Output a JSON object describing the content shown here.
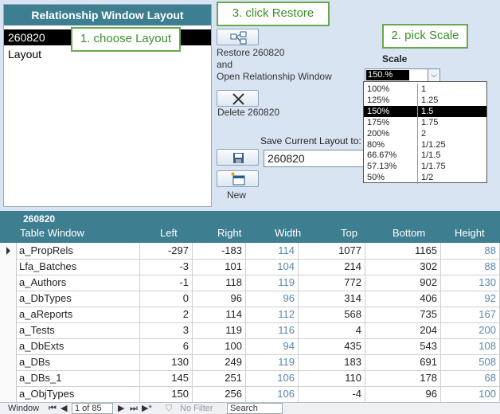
{
  "layout_list": {
    "title": "Relationship Window Layout",
    "items": [
      "260820",
      "Layout"
    ]
  },
  "callouts": {
    "choose": "1. choose Layout",
    "scale": "2. pick Scale",
    "restore": "3. click Restore"
  },
  "actions": {
    "restore_line1": "Restore 260820",
    "restore_line2": "and",
    "restore_line3": "Open Relationship Window",
    "delete_label": "Delete 260820",
    "new_label": "New",
    "save_label": "Save Current Layout to:",
    "save_value": "260820"
  },
  "scale": {
    "label": "Scale",
    "selected": "150.%",
    "options": [
      [
        "100%",
        "1"
      ],
      [
        "125%",
        "1.25"
      ],
      [
        "150%",
        "1.5"
      ],
      [
        "175%",
        "1.75"
      ],
      [
        "200%",
        "2"
      ],
      [
        "80%",
        "1/1.25"
      ],
      [
        "66.67%",
        "1/1.5"
      ],
      [
        "57.13%",
        "1/1.75"
      ],
      [
        "50%",
        "1/2"
      ]
    ],
    "selected_index": 2
  },
  "grid": {
    "caption": "260820",
    "columns": [
      "Table Window",
      "Left",
      "Right",
      "Width",
      "Top",
      "Bottom",
      "Height"
    ],
    "rows": [
      [
        "a_PropRels",
        "-297",
        "-183",
        "114",
        "1077",
        "1165",
        "88"
      ],
      [
        "Lfa_Batches",
        "-3",
        "101",
        "104",
        "214",
        "302",
        "88"
      ],
      [
        "a_Authors",
        "-1",
        "118",
        "119",
        "772",
        "902",
        "130"
      ],
      [
        "a_DbTypes",
        "0",
        "96",
        "96",
        "314",
        "406",
        "92"
      ],
      [
        "a_aReports",
        "2",
        "114",
        "112",
        "568",
        "735",
        "167"
      ],
      [
        "a_Tests",
        "3",
        "119",
        "116",
        "4",
        "204",
        "200"
      ],
      [
        "a_DbExts",
        "6",
        "100",
        "94",
        "435",
        "543",
        "108"
      ],
      [
        "a_DBs",
        "130",
        "249",
        "119",
        "183",
        "691",
        "508"
      ],
      [
        "a_DBs_1",
        "145",
        "251",
        "106",
        "110",
        "178",
        "68"
      ],
      [
        "a_ObjTypes",
        "150",
        "256",
        "106",
        "-4",
        "96",
        "100"
      ]
    ]
  },
  "nav": {
    "window_label": "Window",
    "position": "1 of 85",
    "filter": "No Filter",
    "search": "Search"
  }
}
